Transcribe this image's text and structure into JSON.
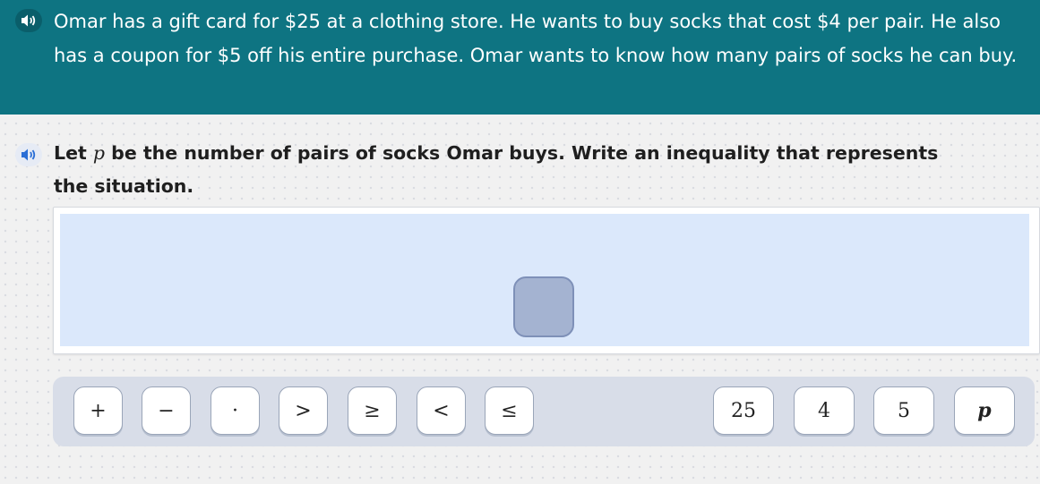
{
  "banner": {
    "audio_icon": "speaker-icon",
    "text": "Omar has a gift card for $25 at a clothing store. He wants to buy socks that cost $4 per pair. He also has a coupon for $5 off his entire purchase. Omar wants to know how many pairs of socks he can buy.",
    "color": "#0e7482"
  },
  "question": {
    "audio_icon": "speaker-icon",
    "prefix": "Let ",
    "variable": "p",
    "suffix": " be the number of pairs of socks Omar buys. Write an inequality that represents the situation."
  },
  "answer": {
    "slots": 1
  },
  "tray": {
    "operators": [
      "+",
      "−",
      "·",
      ">",
      "≥",
      "<",
      "≤"
    ],
    "values": [
      "25",
      "4",
      "5",
      "p"
    ]
  }
}
